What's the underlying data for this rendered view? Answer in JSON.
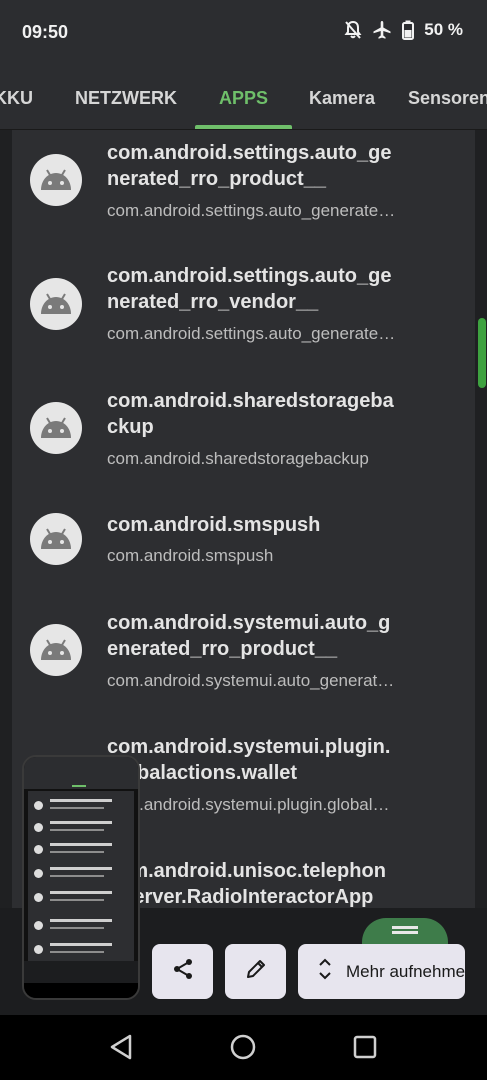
{
  "status_bar": {
    "time": "09:50",
    "battery": "50 %",
    "icons": [
      "notifications-off-icon",
      "airplane-mode-icon",
      "battery-icon"
    ]
  },
  "tabs": [
    {
      "label": "KKU",
      "active": false
    },
    {
      "label": "NETZWERK",
      "active": false
    },
    {
      "label": "APPS",
      "active": true
    },
    {
      "label": "Kamera",
      "active": false
    },
    {
      "label": "Sensoren",
      "active": false
    }
  ],
  "apps": [
    {
      "title": "com.android.settings.auto_generated_rro_product__",
      "subtitle": "com.android.settings.auto_generated_rro_product__"
    },
    {
      "title": "com.android.settings.auto_generated_rro_vendor__",
      "subtitle": "com.android.settings.auto_generated_rro_vendor__"
    },
    {
      "title": "com.android.sharedstoragebackup",
      "subtitle": "com.android.sharedstoragebackup"
    },
    {
      "title": "com.android.smspush",
      "subtitle": "com.android.smspush"
    },
    {
      "title": "com.android.systemui.auto_generated_rro_product__",
      "subtitle": "com.android.systemui.auto_generated_rro_product__"
    },
    {
      "title": "com.android.systemui.plugin.globalactions.wallet",
      "subtitle": "com.android.systemui.plugin.globalactions.wallet"
    },
    {
      "title": "com.android.unisoc.telephony.server.RadioInteractorApp",
      "subtitle": ""
    }
  ],
  "actions": {
    "share_icon": "share-icon",
    "edit_icon": "edit-icon",
    "more_label": "Mehr aufnehmen"
  },
  "colors": {
    "accent": "#6fbf6a",
    "scrollbar": "#3ea240",
    "list_bg": "#2d2e31",
    "button_bg": "#e7e5ee"
  }
}
